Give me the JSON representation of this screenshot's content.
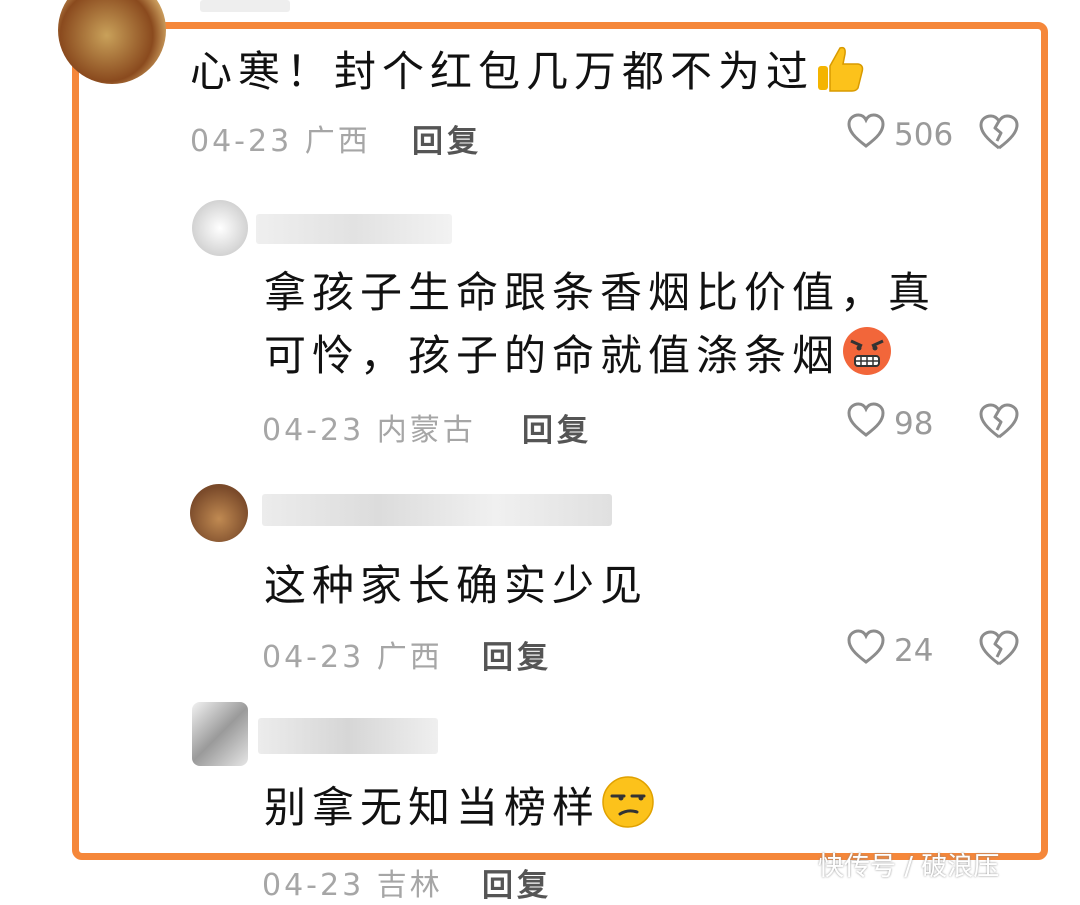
{
  "comments": [
    {
      "text": "心寒！封个红包几万都不为过",
      "emoji": "thumbs-up-icon",
      "date": "04-23",
      "location": "广西",
      "reply_label": "回复",
      "likes": "506"
    },
    {
      "text_line1": "拿孩子生命跟条香烟比价值，真",
      "text_line2": "可怜，孩子的命就值涤条烟",
      "emoji": "angry-face-icon",
      "date": "04-23",
      "location": "内蒙古",
      "reply_label": "回复",
      "likes": "98"
    },
    {
      "text": "这种家长确实少见",
      "date": "04-23",
      "location": "广西",
      "reply_label": "回复",
      "likes": "24"
    },
    {
      "text": "别拿无知当榜样",
      "emoji": "unamused-face-icon",
      "date": "04-23",
      "location": "吉林",
      "reply_label": "回复"
    }
  ],
  "watermark": "快传号 / 破浪压",
  "colors": {
    "frame": "#f5873a",
    "meta": "#a6a6a6",
    "icon": "#8c8c8c"
  }
}
